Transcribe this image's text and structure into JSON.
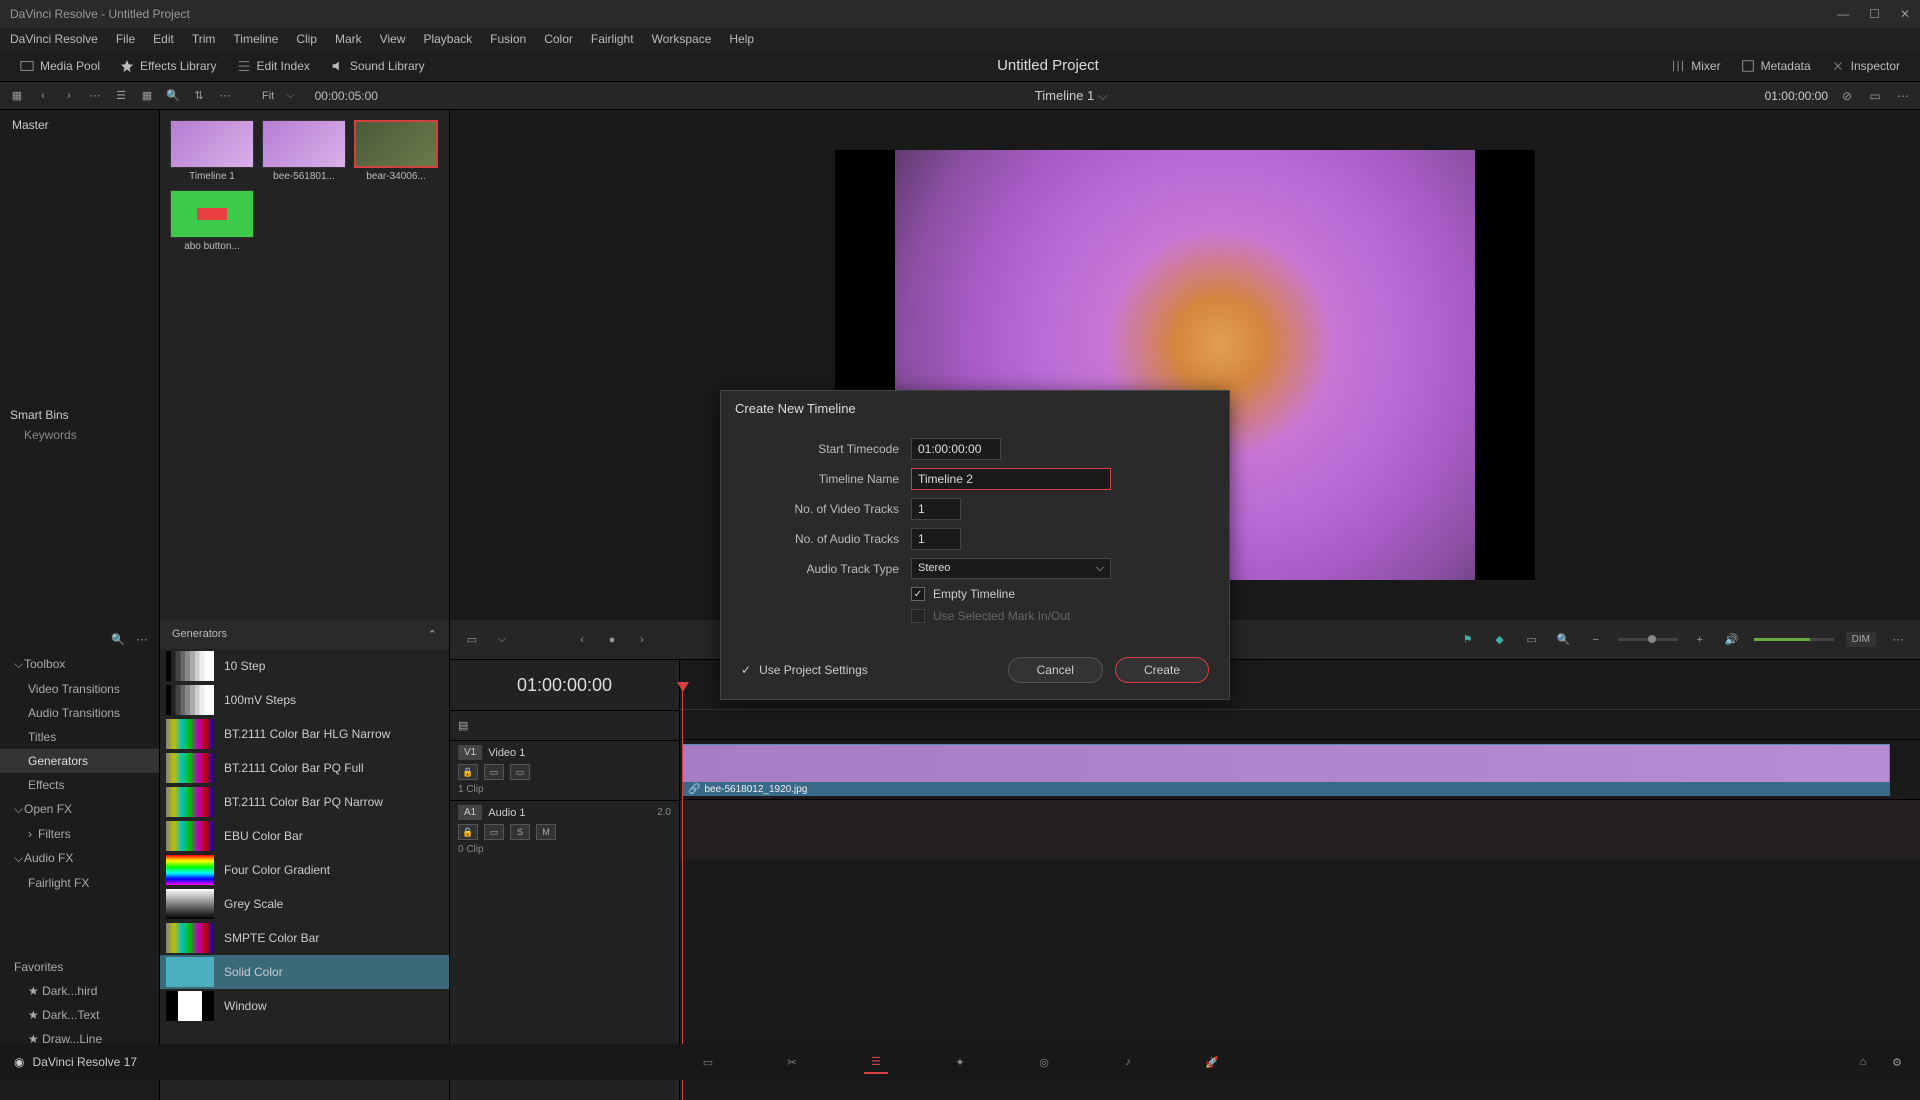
{
  "titlebar": {
    "text": "DaVinci Resolve - Untitled Project"
  },
  "menubar": [
    "DaVinci Resolve",
    "File",
    "Edit",
    "Trim",
    "Timeline",
    "Clip",
    "Mark",
    "View",
    "Playback",
    "Fusion",
    "Color",
    "Fairlight",
    "Workspace",
    "Help"
  ],
  "toolbar": {
    "media_pool": "Media Pool",
    "effects_library": "Effects Library",
    "edit_index": "Edit Index",
    "sound_library": "Sound Library",
    "mixer": "Mixer",
    "metadata": "Metadata",
    "inspector": "Inspector"
  },
  "project_title": "Untitled Project",
  "subbar": {
    "fit": "Fit",
    "source_tc": "00:00:05:00",
    "timeline_name": "Timeline 1",
    "record_tc": "01:00:00:00"
  },
  "media_pool": {
    "master": "Master",
    "smart_bins": "Smart Bins",
    "keywords": "Keywords"
  },
  "clips": [
    {
      "label": "Timeline 1",
      "type": "flower"
    },
    {
      "label": "bee-561801...",
      "type": "flower"
    },
    {
      "label": "bear-34006...",
      "type": "bear",
      "selected": true
    },
    {
      "label": "abo button...",
      "type": "green"
    }
  ],
  "fx_sidebar": {
    "toolbox": "Toolbox",
    "items": [
      "Video Transitions",
      "Audio Transitions",
      "Titles",
      "Generators",
      "Effects"
    ],
    "selected": "Generators",
    "openfx": "Open FX",
    "filters": "Filters",
    "audiofx": "Audio FX",
    "fairlightfx": "Fairlight FX",
    "favorites": "Favorites",
    "fav_items": [
      "Dark...hird",
      "Dark...Text",
      "Draw...Line"
    ]
  },
  "generators": {
    "header": "Generators",
    "items": [
      {
        "name": "10 Step",
        "swatch": "sw-step"
      },
      {
        "name": "100mV Steps",
        "swatch": "sw-step"
      },
      {
        "name": "BT.2111 Color Bar HLG Narrow",
        "swatch": "sw-bars"
      },
      {
        "name": "BT.2111 Color Bar PQ Full",
        "swatch": "sw-bars"
      },
      {
        "name": "BT.2111 Color Bar PQ Narrow",
        "swatch": "sw-bars"
      },
      {
        "name": "EBU Color Bar",
        "swatch": "sw-bars"
      },
      {
        "name": "Four Color Gradient",
        "swatch": "sw-gradient"
      },
      {
        "name": "Grey Scale",
        "swatch": "sw-grey"
      },
      {
        "name": "SMPTE Color Bar",
        "swatch": "sw-bars"
      },
      {
        "name": "Solid Color",
        "swatch": "sw-solid",
        "selected": true
      },
      {
        "name": "Window",
        "swatch": "sw-window"
      }
    ]
  },
  "timeline": {
    "tc": "01:00:00:00",
    "video_track": {
      "badge": "V1",
      "name": "Video 1",
      "clips": "1 Clip"
    },
    "audio_track": {
      "badge": "A1",
      "name": "Audio 1",
      "format": "2.0",
      "clips": "0 Clip"
    },
    "clip_name": "bee-5618012_1920.jpg",
    "dim": "DIM"
  },
  "dialog": {
    "title": "Create New Timeline",
    "start_tc_label": "Start Timecode",
    "start_tc": "01:00:00:00",
    "name_label": "Timeline Name",
    "name": "Timeline 2",
    "video_tracks_label": "No. of Video Tracks",
    "video_tracks": "1",
    "audio_tracks_label": "No. of Audio Tracks",
    "audio_tracks": "1",
    "audio_type_label": "Audio Track Type",
    "audio_type": "Stereo",
    "empty_timeline": "Empty Timeline",
    "use_mark": "Use Selected Mark In/Out",
    "use_project_settings": "Use Project Settings",
    "cancel": "Cancel",
    "create": "Create"
  },
  "bottombar": {
    "version": "DaVinci Resolve 17"
  }
}
